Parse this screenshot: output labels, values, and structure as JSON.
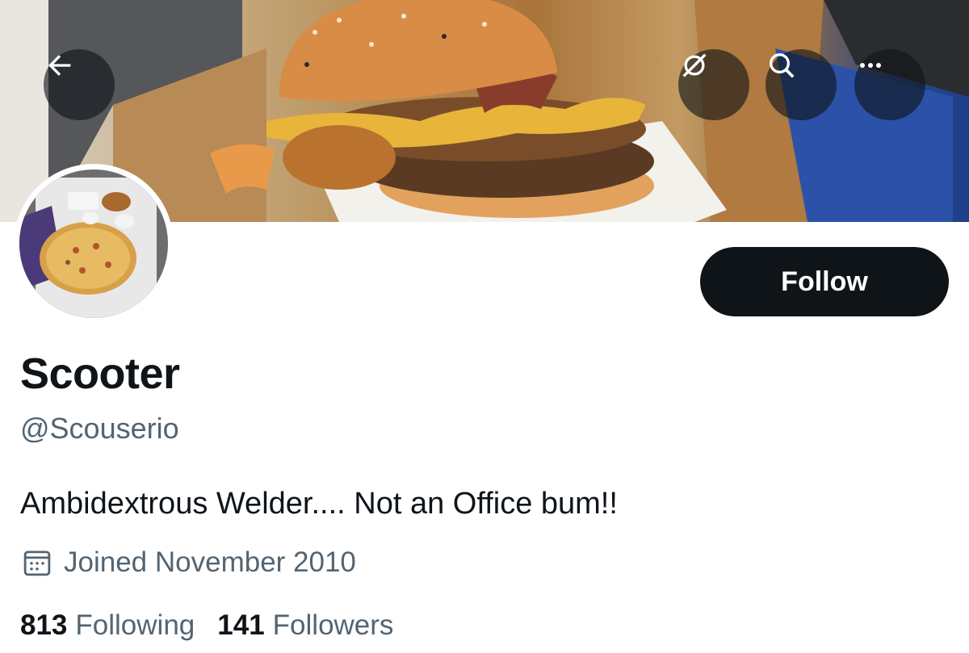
{
  "banner": {
    "back_icon": "back-arrow-icon",
    "translate_icon": "crossed-circle-icon",
    "search_icon": "search-icon",
    "more_icon": "more-horizontal-icon"
  },
  "profile": {
    "follow_label": "Follow",
    "display_name": "Scooter",
    "handle": "@Scouserio",
    "bio": "Ambidextrous Welder.... Not an Office bum!!",
    "joined": "Joined November 2010",
    "following_count": "813",
    "following_label": "Following",
    "followers_count": "141",
    "followers_label": "Followers"
  },
  "colors": {
    "primary_text": "#0f1419",
    "secondary_text": "#536471",
    "follow_bg": "#0f1419"
  }
}
